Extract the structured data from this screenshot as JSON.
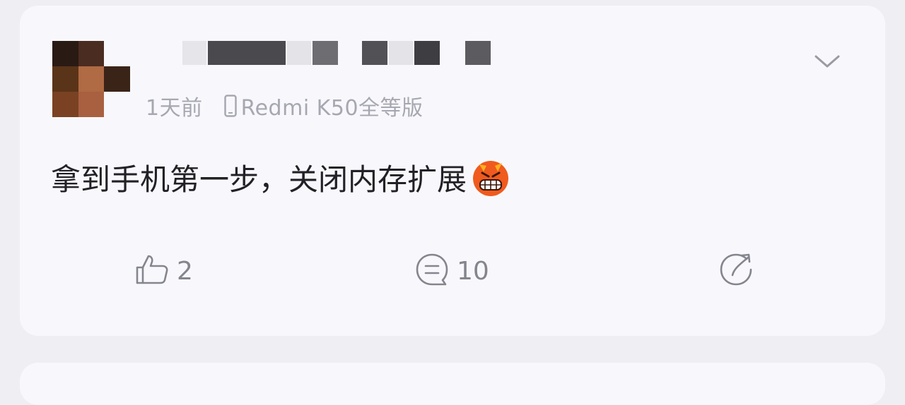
{
  "post": {
    "time": "1天前",
    "device": "Redmi K50全等版",
    "content": "拿到手机第一步，关闭内存扩展",
    "emoji": "angry-emoji"
  },
  "actions": {
    "likes": "2",
    "comments": "10"
  },
  "icons": [
    "like-icon",
    "comment-icon",
    "share-icon",
    "chevron-down-icon",
    "phone-icon"
  ]
}
